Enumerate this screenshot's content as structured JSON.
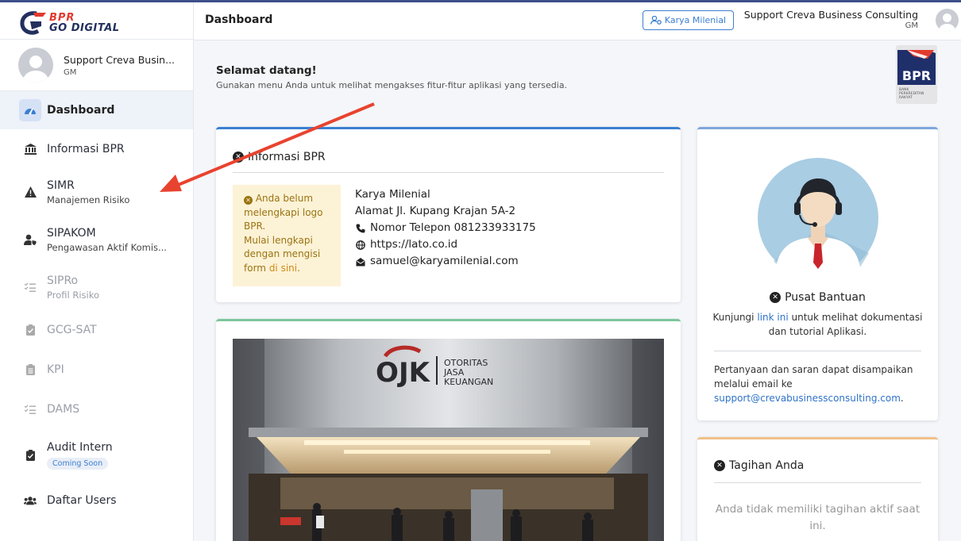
{
  "app": {
    "logo_top": "BPR",
    "logo_bottom": "GO DIGITAL"
  },
  "sidebar": {
    "user_name": "Support Creva Busin...",
    "user_role": "GM",
    "items": [
      {
        "label": "Dashboard",
        "sub": "",
        "icon": "gauge-icon"
      },
      {
        "label": "Informasi BPR",
        "sub": "",
        "icon": "bank-icon"
      },
      {
        "label": "SIMR",
        "sub": "Manajemen Risiko",
        "icon": "warning-icon"
      },
      {
        "label": "SIPAKOM",
        "sub": "Pengawasan Aktif Komis...",
        "icon": "user-shield-icon"
      },
      {
        "label": "SIPRo",
        "sub": "Profil Risiko",
        "icon": "list-check-icon"
      },
      {
        "label": "GCG-SAT",
        "sub": "",
        "icon": "clipboard-check-icon"
      },
      {
        "label": "KPI",
        "sub": "",
        "icon": "clipboard-list-icon"
      },
      {
        "label": "DAMS",
        "sub": "",
        "icon": "list-check-icon"
      },
      {
        "label": "Audit Intern",
        "sub": "",
        "badge": "Coming Soon",
        "icon": "clipboard-check-icon"
      },
      {
        "label": "Daftar Users",
        "sub": "",
        "icon": "users-icon"
      }
    ]
  },
  "header": {
    "title": "Dashboard",
    "company_button": "Karya Milenial",
    "user_name": "Support Creva Business Consulting",
    "user_role": "GM"
  },
  "welcome": {
    "title": "Selamat datang!",
    "subtitle": "Gunakan menu Anda untuk melihat mengakses fitur-fitur aplikasi yang tersedia."
  },
  "bpr_logo": {
    "text": "BPR",
    "caption_1": "BANK",
    "caption_2": "PERKREDITAN",
    "caption_3": "RAKYAT"
  },
  "info_card": {
    "title": "Informasi BPR",
    "warning_1": "Anda belum melengkapi logo BPR.",
    "warning_2": "Mulai lengkapi dengan mengisi form",
    "warning_link": "di sini",
    "warning_end": ".",
    "company": "Karya Milenial",
    "address": "Alamat Jl. Kupang Krajan 5A-2",
    "phone": "Nomor Telepon 081233933175",
    "website": "https://lato.co.id",
    "email": "samuel@karyamilenial.com"
  },
  "photo": {
    "sign_line1": "OTORITAS",
    "sign_line2": "JASA",
    "sign_line3": "KEUANGAN",
    "sign_logo": "OJK"
  },
  "help_card": {
    "title": "Pusat Bantuan",
    "text_before": "Kunjungi",
    "link": "link ini",
    "text_after": "untuk melihat dokumentasi dan tutorial Aplikasi.",
    "contact_text": "Pertanyaan dan saran dapat disampaikan melalui email ke",
    "contact_email": "support@crevabusinessconsulting.com",
    "contact_end": "."
  },
  "billing_card": {
    "title": "Tagihan Anda",
    "empty_text": "Anda tidak memiliki tagihan aktif saat ini."
  },
  "colors": {
    "accent_blue": "#3b7fd1",
    "card_top_blue": "#3b7fd1",
    "card_top_green": "#7cc69b",
    "card_top_orange": "#f0c088",
    "warning_bg": "#fcf2d6",
    "arrow_red": "#e8432f"
  }
}
